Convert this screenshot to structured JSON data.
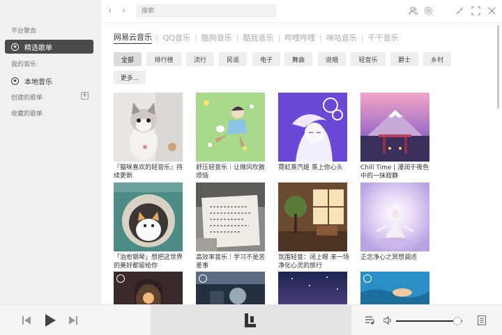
{
  "sidebar": {
    "sections": [
      "平台聚合",
      "我的音乐"
    ],
    "items": [
      {
        "label": "精选歌单",
        "active": true,
        "icon": "star-icon"
      },
      {
        "label": "本地音乐",
        "active": false,
        "icon": "star-icon"
      }
    ],
    "created_playlists": "创建的歌单",
    "collected_playlists": "收藏的歌单"
  },
  "topbar": {
    "search_placeholder": "搜索",
    "icons": [
      "back-icon",
      "forward-icon",
      "user-icon",
      "settings-icon",
      "minimize-icon",
      "maximize-icon",
      "close-icon"
    ]
  },
  "platform_tabs": [
    "网易云音乐",
    "QQ音乐",
    "酷狗音乐",
    "酷我音乐",
    "哔哩哔哩",
    "咪咕音乐",
    "千千音乐"
  ],
  "categories": [
    "全部",
    "排行榜",
    "流行",
    "民谣",
    "电子",
    "舞曲",
    "说唱",
    "轻音乐",
    "爵士",
    "乡村",
    "更多..."
  ],
  "playlists": [
    {
      "title": "『猫咪喜欢的轻音乐』持续更新"
    },
    {
      "title": "舒压轻音乐｜让微风吹散烦恼"
    },
    {
      "title": "霓虹蒸汽姬 蒸上你心头"
    },
    {
      "title": "Chill Time | 漫润于夜色中的一抹寂静"
    },
    {
      "title": "「治愈钢琴」想把这世界的美好都留给你"
    },
    {
      "title": "高效率音乐｜学习不是苦差事"
    },
    {
      "title": "氛围轻音：闭上眼 来一场净化心灵的旅行"
    },
    {
      "title": "正念净心之冥想调适"
    },
    {
      "title": ""
    },
    {
      "title": ""
    },
    {
      "title": ""
    },
    {
      "title": ""
    }
  ],
  "player": {
    "icons": [
      "previous-icon",
      "play-icon",
      "next-icon",
      "playlist-icon",
      "volume-icon",
      "queue-icon"
    ],
    "volume_fraction": 0.93,
    "accent": "#2b2b2b"
  }
}
